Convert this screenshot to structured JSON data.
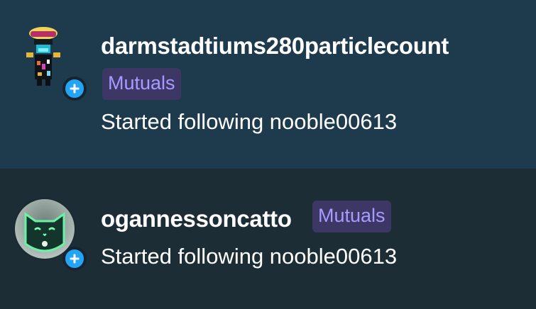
{
  "activities": [
    {
      "username": "darmstadtiums280particlecount",
      "relationship_badge": "Mutuals",
      "status": "Started following nooble00613",
      "avatar_icon": "pixel-art-robot-icon",
      "follow_badge_icon": "plus-icon"
    },
    {
      "username": "ogannessoncatto",
      "relationship_badge": "Mutuals",
      "status": "Started following nooble00613",
      "avatar_icon": "green-cat-icon",
      "follow_badge_icon": "plus-icon"
    }
  ],
  "colors": {
    "row_highlight": "#1e3b4e",
    "row_default": "#1d2d36",
    "badge_background": "#3c3764",
    "badge_text": "#a69cff",
    "follow_badge": "#22a5f4"
  }
}
